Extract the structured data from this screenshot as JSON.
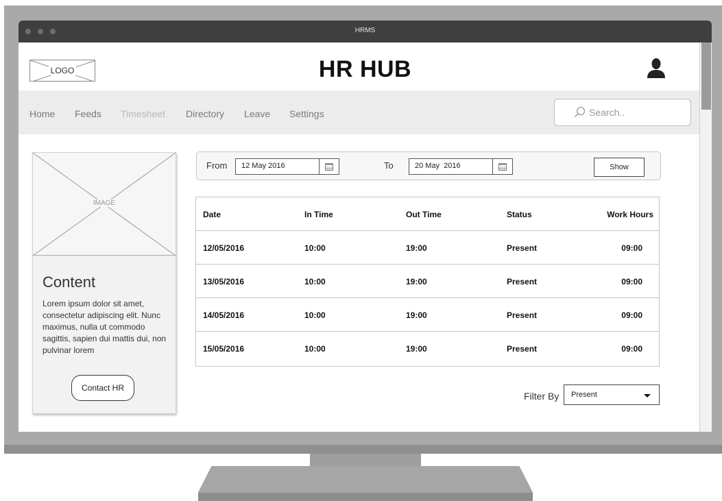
{
  "window": {
    "title": "HRMS"
  },
  "header": {
    "logo_text": "LOGO",
    "app_title": "HR HUB",
    "user_icon": "user-icon"
  },
  "nav": {
    "items": [
      {
        "label": "Home",
        "state": "normal"
      },
      {
        "label": "Feeds",
        "state": "normal"
      },
      {
        "label": "Timesheet",
        "state": "active-muted"
      },
      {
        "label": "Directory",
        "state": "normal"
      },
      {
        "label": "Leave",
        "state": "normal"
      },
      {
        "label": "Settings",
        "state": "normal"
      }
    ],
    "search": {
      "placeholder": "Search..",
      "value": "",
      "icon": "search-icon"
    }
  },
  "card": {
    "image_label": "IMAGE",
    "title": "Content",
    "text": "Lorem ipsum dolor sit amet, consectetur adipiscing elit. Nunc maximus, nulla ut commodo sagittis, sapien dui mattis dui, non pulvinar lorem",
    "button_label": "Contact HR"
  },
  "date_filter": {
    "from_label": "From",
    "from_value": "12 May 2016",
    "to_label": "To",
    "to_value": "20 May  2016",
    "calendar_icon": "calendar-icon",
    "show_label": "Show"
  },
  "table": {
    "headers": [
      "Date",
      "In Time",
      "Out Time",
      "Status",
      "Work Hours"
    ],
    "rows": [
      [
        "12/05/2016",
        "10:00",
        "19:00",
        "Present",
        "09:00"
      ],
      [
        "13/05/2016",
        "10:00",
        "19:00",
        "Present",
        "09:00"
      ],
      [
        "14/05/2016",
        "10:00",
        "19:00",
        "Present",
        "09:00"
      ],
      [
        "15/05/2016",
        "10:00",
        "19:00",
        "Present",
        "09:00"
      ]
    ]
  },
  "filter": {
    "label": "Filter By",
    "selected": "Present"
  },
  "colors": {
    "titlebar": "#3f3f3f",
    "navbar": "#ececec",
    "monitor": "#a9a9a9"
  }
}
